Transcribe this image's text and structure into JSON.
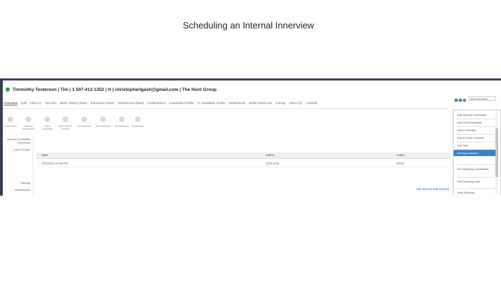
{
  "slide": {
    "title": "Scheduling an Internal Innerview"
  },
  "header": {
    "candidate_line": "Timmothy Testerson | Tim | 1 507-412-1352 | H | christopherlgash@gmail.com | The Hunt Group"
  },
  "tabs": [
    "Overview",
    "Edit",
    "Files (1)",
    "Tax Info",
    "Work History (New)",
    "Education (New)",
    "References (New)",
    "Certifications",
    "Candidate Profile",
    "IT Candidate Profile",
    "References",
    "Skills Check List",
    "Activity",
    "Notes (1)",
    "Linkedin"
  ],
  "pipeline": [
    {
      "label": "Cold Sheet"
    },
    {
      "label": "Internal Submission"
    },
    {
      "label": "Client Submittal"
    },
    {
      "label": "Client Phone Screen"
    },
    {
      "label": "1st Interview"
    },
    {
      "label": "2nd Interview"
    },
    {
      "label": "3rd Interview"
    },
    {
      "label": "Placement"
    }
  ],
  "side_labels": {
    "general": "General Candidates Comments:",
    "last_hr": "Last Hr Notes:",
    "tracking": "Tracking:",
    "submissions": "Submissions:"
  },
  "table": {
    "columns": [
      "Date",
      "Author",
      "Action"
    ],
    "rows": [
      {
        "date": "4/11/2013 12:58 PM",
        "author": "Chris Gott",
        "action": "Email"
      }
    ]
  },
  "links": {
    "add_submission": "Add Internal Submissions"
  },
  "select_action": {
    "value": "Select an Action"
  },
  "action_menu": {
    "items": [
      "Add Internal Submission",
      "Add Client Submittal",
      "Add to Shortlist",
      "Add to Email Contacts",
      "Add Task",
      "Add Appointment",
      "Find Matching Candidates",
      "Run Matching Jobs",
      "View Referrals"
    ],
    "highlighted": "Add Appointment"
  },
  "colors": {
    "accent": "#3b82c4",
    "status": "#2e9b4e",
    "frame": "#3a3f5a"
  }
}
